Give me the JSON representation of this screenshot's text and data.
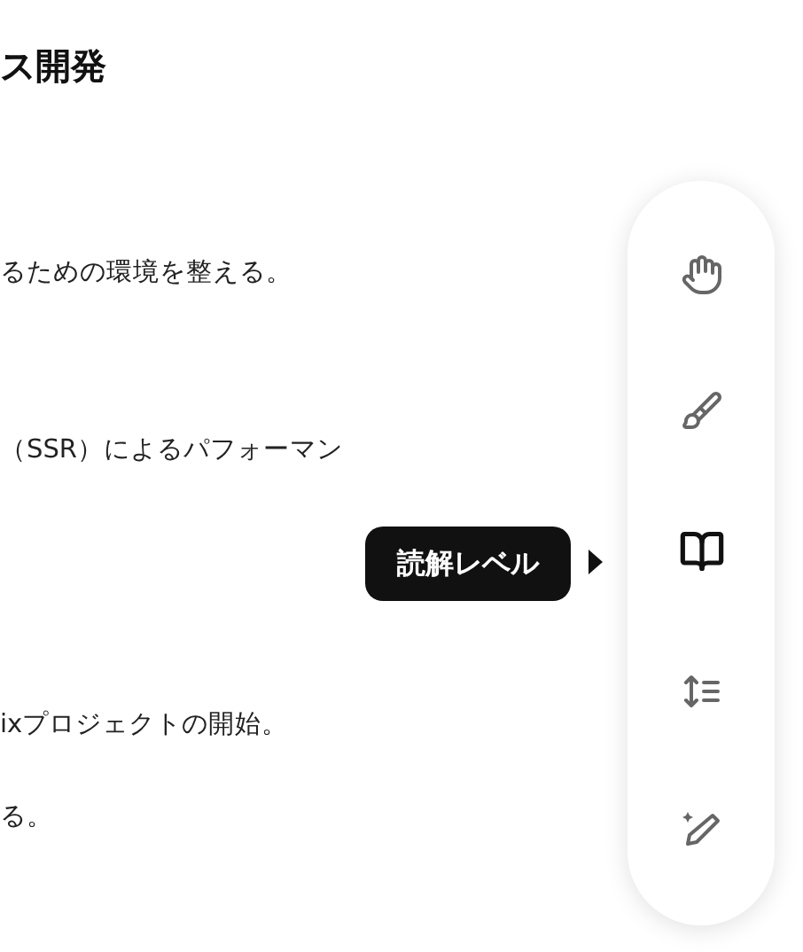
{
  "article": {
    "heading": "ス開発",
    "lines": [
      {
        "text": "るための環境を整える。"
      },
      {
        "text": "（SSR）によるパフォーマン"
      },
      {
        "text": "ixプロジェクトの開始。"
      },
      {
        "text": "る。"
      }
    ]
  },
  "toolbar": {
    "items": [
      {
        "kind": "hand",
        "selected": false
      },
      {
        "kind": "brush",
        "selected": false
      },
      {
        "kind": "book",
        "selected": true
      },
      {
        "kind": "line-height",
        "selected": false
      },
      {
        "kind": "pencil-sparkle",
        "selected": false
      }
    ],
    "tooltip": "読解レベル"
  }
}
